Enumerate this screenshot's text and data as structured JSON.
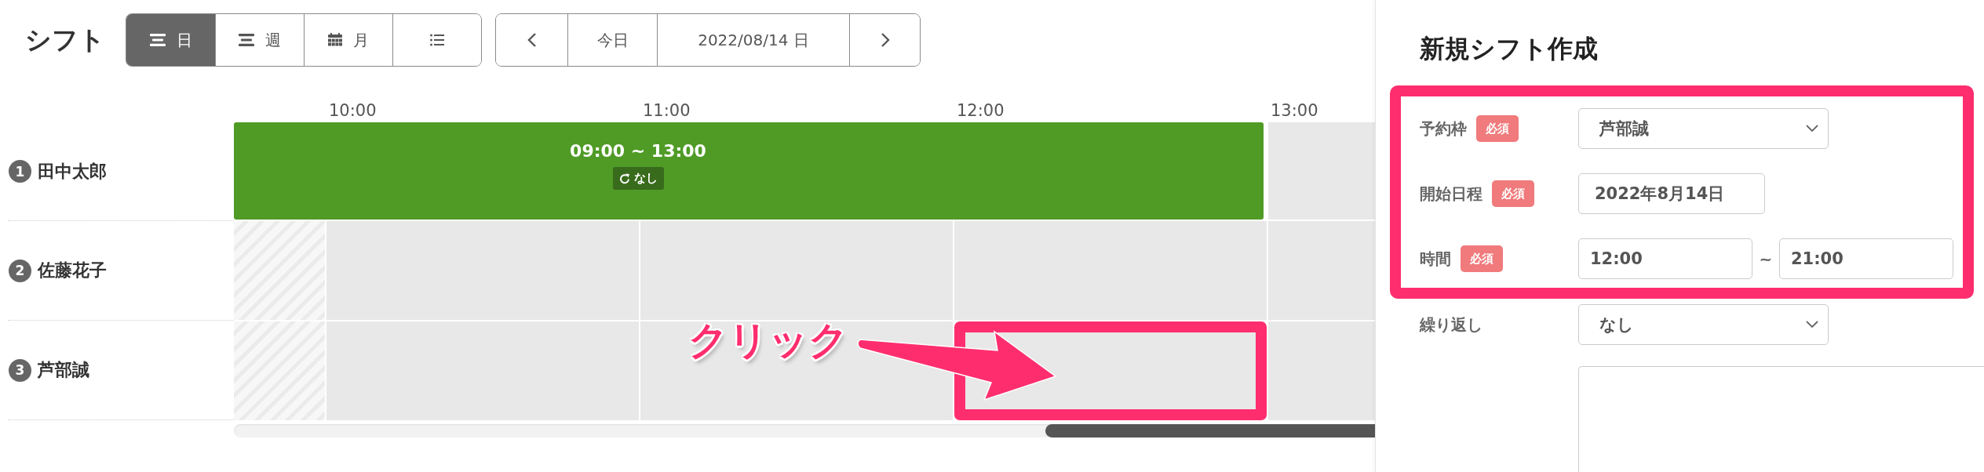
{
  "header": {
    "title": "シフト"
  },
  "view_tabs": [
    {
      "kind": "bars",
      "label": "日",
      "selected": true
    },
    {
      "kind": "bars",
      "label": "週",
      "selected": false
    },
    {
      "kind": "calendar",
      "label": "月",
      "selected": false
    },
    {
      "kind": "list",
      "selected": false
    }
  ],
  "date_nav": {
    "today": "今日",
    "date": "2022/08/14 日"
  },
  "timeline": {
    "columns": [
      {
        "available": false
      },
      {
        "label": "10:00",
        "available": true
      },
      {
        "label": "11:00",
        "available": true
      },
      {
        "label": "12:00",
        "available": true
      },
      {
        "label": "13:00",
        "available": true
      }
    ],
    "staff": [
      {
        "number": "1",
        "name": "田中太郎",
        "shift": {
          "time": "09:00 ~ 13:00",
          "repeat": "なし"
        }
      },
      {
        "number": "2",
        "name": "佐藤花子"
      },
      {
        "number": "3",
        "name": "芦部誠"
      }
    ]
  },
  "callout": {
    "text": "クリック"
  },
  "form": {
    "title": "新規シフト作成",
    "highlighted_fields": [
      {
        "label": "予約枠",
        "badge": "必須",
        "kind": "select",
        "value": "芦部誠"
      },
      {
        "label": "開始日程",
        "badge": "必須",
        "kind": "text",
        "value": "2022年8月14日"
      },
      {
        "label": "時間",
        "badge": "必須",
        "kind": "time_range",
        "from": "12:00",
        "separator": "~",
        "to": "21:00"
      }
    ],
    "fields": [
      {
        "label": "繰り返し",
        "kind": "select",
        "value": "なし"
      },
      {
        "kind": "textarea"
      }
    ]
  }
}
